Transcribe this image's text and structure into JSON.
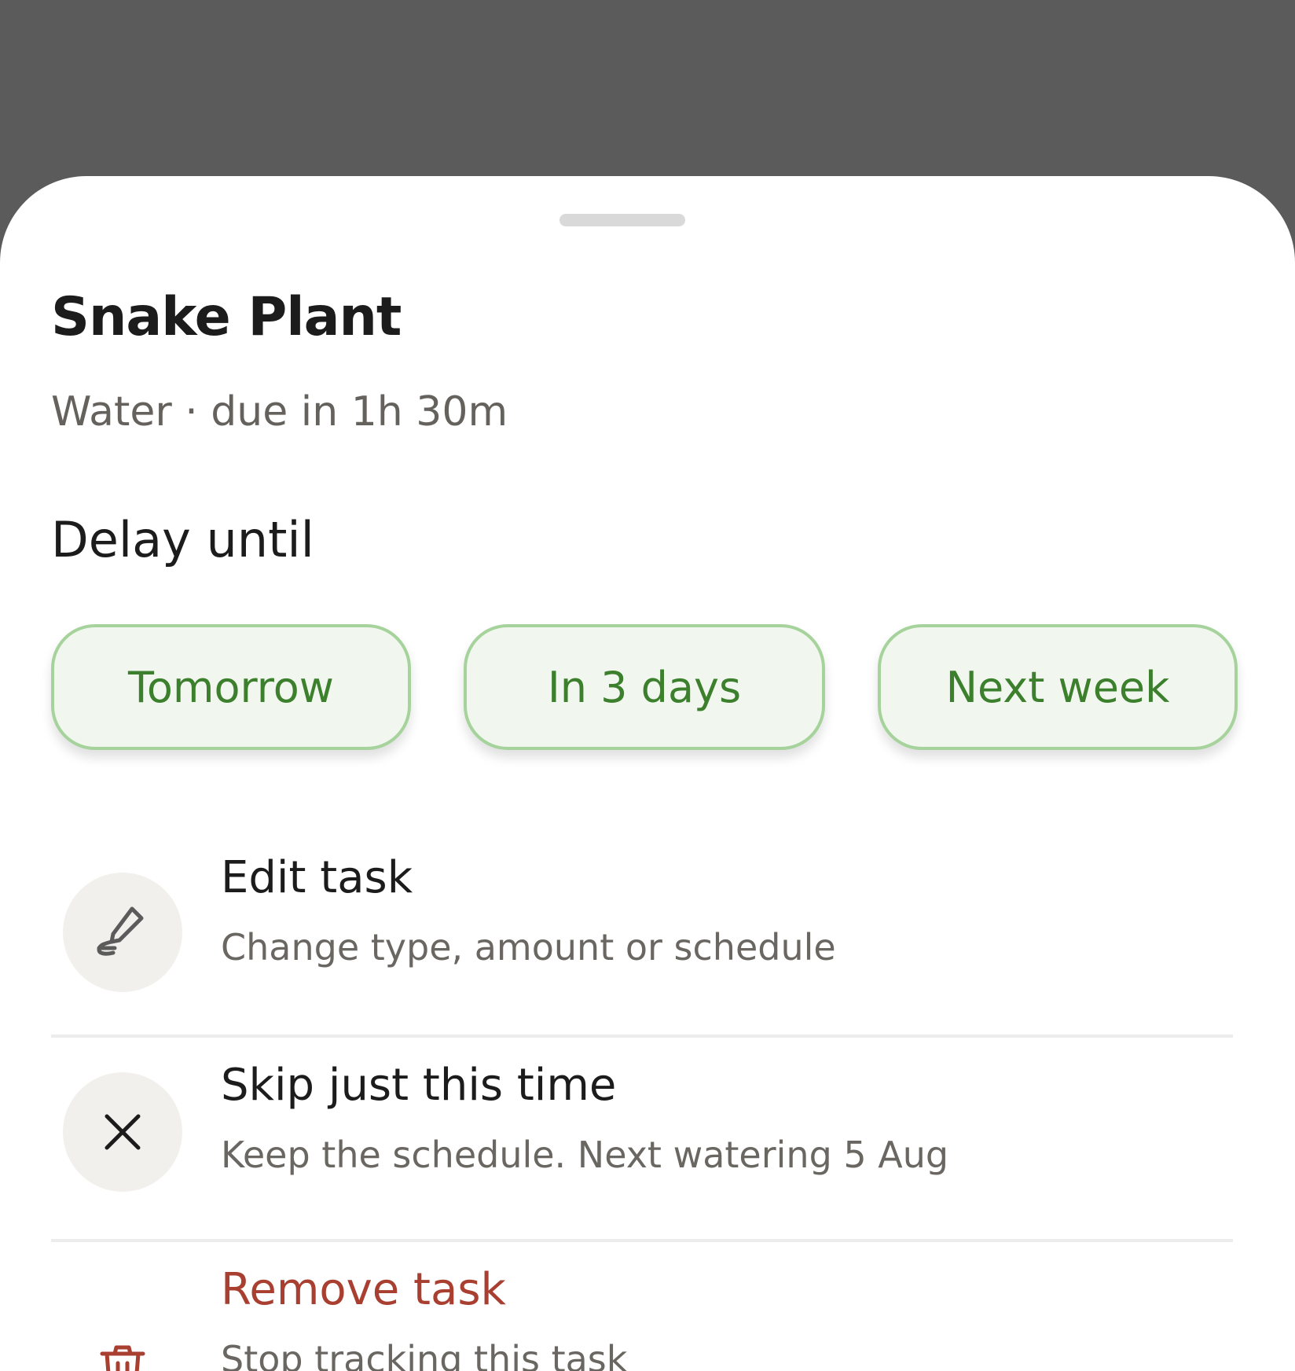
{
  "sheet": {
    "plant_name": "Snake Plant",
    "task_summary": "Water · due in 1h 30m",
    "delay_label": "Delay until",
    "delay_options": [
      "Tomorrow",
      "In 3 days",
      "Next week"
    ]
  },
  "actions": [
    {
      "title": "Edit task",
      "subtitle": "Change type, amount or schedule",
      "icon": "pencil-icon"
    },
    {
      "title": "Skip just this time",
      "subtitle": "Keep the schedule. Next watering 5 Aug",
      "icon": "close-icon"
    },
    {
      "title": "Remove task",
      "subtitle": "Stop tracking this task",
      "icon": "trash-icon"
    }
  ],
  "colors": {
    "accent_green": "#3c7f2c",
    "chip_border": "#a6d39c",
    "chip_bg": "#f1f7ef",
    "danger": "#a83f30"
  }
}
